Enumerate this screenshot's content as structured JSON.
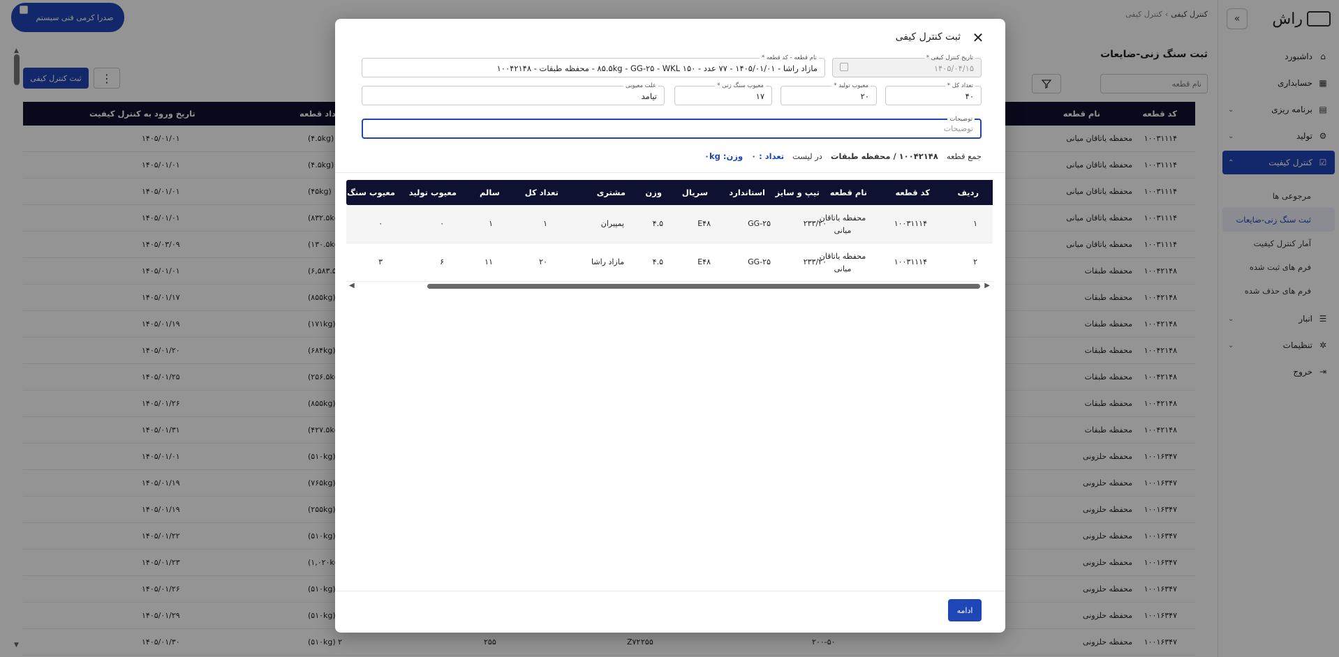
{
  "sidebar": {
    "logo_text": "راش",
    "items": [
      {
        "label": "داشبورد",
        "icon": "home-icon",
        "chev": ""
      },
      {
        "label": "حسابداری",
        "icon": "calculator-icon",
        "chev": ""
      },
      {
        "label": "برنامه ریزی",
        "icon": "calendar-icon",
        "chev": "⌄"
      },
      {
        "label": "تولید",
        "icon": "gear-icon",
        "chev": "⌄"
      },
      {
        "label": "کنترل کیفیت",
        "icon": "checkbox-icon",
        "chev": "⌃"
      }
    ],
    "sub_items": [
      "مرجوعی ها",
      "ثبت سنگ زنی-ضایعات",
      "آمار کنترل کیفیت",
      "فرم های ثبت شده",
      "فرم های حذف شده"
    ],
    "items_after": [
      {
        "label": "انبار",
        "icon": "database-icon",
        "chev": "⌄"
      },
      {
        "label": "تنظیمات",
        "icon": "settings-icon",
        "chev": "⌄"
      },
      {
        "label": "خروج",
        "icon": "logout-icon",
        "chev": ""
      }
    ]
  },
  "header": {
    "support_label": "صدرا کرمی فنی سیستم",
    "breadcrumb": [
      "کنترل کیفی",
      "کنترل کیفی"
    ]
  },
  "page": {
    "title": "ثبت سنگ زنی-ضایعات",
    "search_placeholder": "نام قطعه",
    "add_button": "ثبت کنترل کیفی",
    "columns": {
      "code": "کد قطعه",
      "name": "نام قطعه",
      "count": "تعداد قطعه",
      "date": "تاریخ ورود به کنترل کیفیت"
    },
    "rows": [
      {
        "code": "۱۰۰۳۱۱۱۴",
        "name": "محفظه یاتاقان میانی",
        "count": "۱ (۴.۵kg)",
        "date": "۱۴۰۵/۰۱/۰۱"
      },
      {
        "code": "۱۰۰۳۱۱۱۴",
        "name": "محفظه یاتاقان میانی",
        "count": "۱ (۴.۵kg)",
        "date": "۱۴۰۵/۰۱/۰۱"
      },
      {
        "code": "۱۰۰۳۱۱۱۴",
        "name": "محفظه یاتاقان میانی",
        "count": "۱۰ (۴۵kg)",
        "date": "۱۴۰۵/۰۱/۰۱"
      },
      {
        "code": "۱۰۰۳۱۱۱۴",
        "name": "محفظه یاتاقان میانی",
        "count": "۱۸۵ (۸۳۲.۵kg)",
        "date": "۱۴۰۵/۰۱/۰۱"
      },
      {
        "code": "۱۰۰۳۱۱۱۴",
        "name": "محفظه یاتاقان میانی",
        "count": "۲۹ (۱۳۰.۵kg)",
        "date": "۱۴۰۵/۰۳/۰۹"
      },
      {
        "code": "۱۰۰۴۲۱۴۸",
        "name": "محفظه طبقات",
        "count": "۷۷ (۶,۵۸۳.۵kg)",
        "date": "۱۴۰۵/۰۱/۰۱"
      },
      {
        "code": "۱۰۰۴۲۱۴۸",
        "name": "محفظه طبقات",
        "count": "۱۰ (۸۵۵kg)",
        "date": "۱۴۰۵/۰۱/۱۷"
      },
      {
        "code": "۱۰۰۴۲۱۴۸",
        "name": "محفظه طبقات",
        "count": "۲ (۱۷۱kg)",
        "date": "۱۴۰۵/۰۱/۱۹"
      },
      {
        "code": "۱۰۰۴۲۱۴۸",
        "name": "محفظه طبقات",
        "count": "۸ (۶۸۴kg)",
        "date": "۱۴۰۵/۰۱/۲۰"
      },
      {
        "code": "۱۰۰۴۲۱۴۸",
        "name": "محفظه طبقات",
        "count": "۳ (۲۵۶.۵kg)",
        "date": "۱۴۰۵/۰۱/۲۵"
      },
      {
        "code": "۱۰۰۴۲۱۴۸",
        "name": "محفظه طبقات",
        "count": "۱۰ (۸۵۵kg)",
        "date": "۱۴۰۵/۰۱/۲۶"
      },
      {
        "code": "۱۰۰۴۲۱۴۸",
        "name": "محفظه طبقات",
        "count": "۵ (۴۲۷.۵kg)",
        "date": "۱۴۰۵/۰۱/۳۱"
      },
      {
        "code": "۱۰۰۱۶۳۴۷",
        "name": "محفظه حلزونی",
        "count": "۲ (۵۱۰kg)",
        "date": "۱۴۰۵/۰۱/۰۱"
      },
      {
        "code": "۱۰۰۱۶۳۴۷",
        "name": "محفظه حلزونی",
        "count": "۳ (۷۶۵kg)",
        "date": "۱۴۰۵/۰۱/۱۹"
      },
      {
        "code": "۱۰۰۱۶۳۴۷",
        "name": "محفظه حلزونی",
        "count": "۱ (۲۵۵kg)",
        "date": "۱۴۰۵/۰۱/۱۹"
      },
      {
        "code": "۱۰۰۱۶۳۴۷",
        "name": "محفظه حلزونی",
        "count": "۲ (۵۱۰kg)",
        "date": "۱۴۰۵/۰۱/۲۲"
      },
      {
        "code": "۱۰۰۱۶۳۴۷",
        "name": "محفظه حلزونی",
        "count": "۴ (۱,۰۲۰kg)",
        "date": "۱۴۰۵/۰۱/۲۳"
      },
      {
        "code": "۱۰۰۱۶۳۴۷",
        "name": "محفظه حلزونی",
        "count": "۲ (۵۱۰kg)",
        "date": "۱۴۰۵/۰۱/۲۶"
      },
      {
        "code": "۱۰۰۱۶۳۴۷",
        "name": "محفظه حلزونی",
        "count": "۲ (۵۱۰kg)",
        "date": "۱۴۰۵/۰۱/۲۹"
      },
      {
        "code": "۱۰۰۱۶۳۴۷",
        "name": "محفظه حلزونی",
        "count": "۲ (۵۱۰kg)",
        "date": "۱۴۰۵/۰۱/۳۰",
        "extra": [
          "۲۰۰-۵۰",
          "Z۷۲",
          "۲۵۵",
          "۲۵۵"
        ]
      }
    ]
  },
  "modal": {
    "title": "ثبت کنترل کیفی",
    "fields": {
      "date_label": "تاریخ کنترل کیفی *",
      "date_value": "۱۴۰۵/۰۴/۱۵",
      "part_label": "نام قطعه - کد قطعه *",
      "part_value": "مازاد راشا - ۱۴۰۵/۰۱/۰۱ - ۷۷ عدد - ۸۵.۵kg - GG-۲۵ - WKL ۱۵۰ - محفظه طبقات - ۱۰۰۴۲۱۴۸",
      "total_label": "تعداد کل *",
      "total_value": "۴۰",
      "prod_defect_label": "معیوب تولید *",
      "prod_defect_value": "۲۰",
      "grind_defect_label": "معیوب سنگ زنی *",
      "grind_defect_value": "۱۷",
      "reason_label": "علت معیوبی",
      "reason_value": "تیامد",
      "notes_label": "توضیحات",
      "notes_placeholder": "توضیحات"
    },
    "summary": {
      "sum_label": "جمع قطعه",
      "part": "۱۰۰۴۲۱۴۸ / محفظه طبقات",
      "in_list": "در لیست",
      "count": "تعداد : ۰",
      "weight": "وزن: ۰kg"
    },
    "table": {
      "columns": [
        "ردیف",
        "کد قطعه",
        "نام قطعه",
        "تیپ و سایز",
        "استاندارد",
        "سریال",
        "وزن",
        "مشتری",
        "تعداد کل",
        "سالم",
        "معیوب تولید",
        "معیوب سنگ"
      ],
      "rows": [
        [
          "۱",
          "۱۰۰۳۱۱۱۴",
          "محفظه یاتاقان میانی",
          "۲۳۳/۲۰",
          "GG-۲۵",
          "E۴۸",
          "۴.۵",
          "پمپیران",
          "۱",
          "۱",
          "۰",
          "۰"
        ],
        [
          "۲",
          "۱۰۰۳۱۱۱۴",
          "محفظه یاتاقان میانی",
          "۲۳۳/۲۰",
          "GG-۲۵",
          "E۴۸",
          "۴.۵",
          "مازاد راشا",
          "۲۰",
          "۱۱",
          "۶",
          "۳"
        ]
      ]
    },
    "continue_label": "ادامه"
  }
}
